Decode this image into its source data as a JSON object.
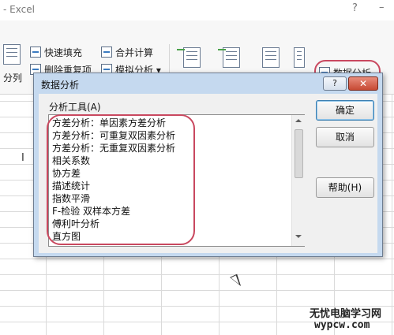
{
  "window": {
    "title": "- Excel",
    "help_glyph": "?",
    "minimize_glyph": "–"
  },
  "ribbon": {
    "flash_fill": "快速填充",
    "consolidate": "合并计算",
    "remove_dup": "删除重复项",
    "what_if": "模拟分析 ▾",
    "text_to_columns": "分列",
    "data_analysis": "数据分析"
  },
  "dialog": {
    "title": "数据分析",
    "help_glyph": "?",
    "close_glyph": "✕",
    "tools_label": "分析工具(A)",
    "tools": [
      "方差分析：单因素方差分析",
      "方差分析：可重复双因素分析",
      "方差分析：无重复双因素分析",
      "相关系数",
      "协方差",
      "描述统计",
      "指数平滑",
      "F-检验 双样本方差",
      "傅利叶分析",
      "直方图"
    ],
    "ok_label": "确定",
    "cancel_label": "取消",
    "help_label": "帮助(H)"
  },
  "watermark": {
    "line1": "无忧电脑学习网",
    "line2": "wypcw.com"
  },
  "colors": {
    "highlight": "#c9485f",
    "dialog_frame": "#c5d9ef"
  }
}
